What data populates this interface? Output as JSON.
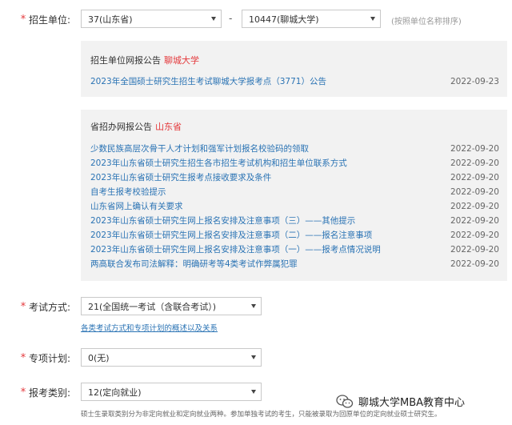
{
  "form": {
    "unit": {
      "label": "招生单位:",
      "province": "37(山东省)",
      "school": "10447(聊城大学)",
      "separator": "-",
      "hint": "(按照单位名称排序)"
    },
    "exam_method": {
      "label": "考试方式:",
      "value": "21(全国统一考试（含联合考试）)",
      "link": "各类考试方式和专项计划的概述以及关系"
    },
    "special_plan": {
      "label": "专项计划:",
      "value": "0(无)"
    },
    "category": {
      "label": "报考类别:",
      "value": "12(定向就业)",
      "note": "硕士生录取类别分为非定向就业和定向就业两种。参加单独考试的考生，只能被录取为回原单位的定向就业硕士研究生。"
    }
  },
  "school_notice": {
    "title": "招生单位网报公告",
    "source": "聊城大学",
    "items": [
      {
        "text": "2023年全国硕士研究生招生考试聊城大学报考点（3771）公告",
        "date": "2022-09-23"
      }
    ]
  },
  "province_notice": {
    "title": "省招办网报公告",
    "source": "山东省",
    "items": [
      {
        "text": "少数民族高层次骨干人才计划和强军计划报名校验码的领取",
        "date": "2022-09-20"
      },
      {
        "text": "2023年山东省硕士研究生招生各市招生考试机构和招生单位联系方式",
        "date": "2022-09-20"
      },
      {
        "text": "2023年山东省硕士研究生报考点接收要求及条件",
        "date": "2022-09-20"
      },
      {
        "text": "自考生报考校验提示",
        "date": "2022-09-20"
      },
      {
        "text": "山东省网上确认有关要求",
        "date": "2022-09-20"
      },
      {
        "text": "2023年山东省硕士研究生网上报名安排及注意事项（三）——其他提示",
        "date": "2022-09-20"
      },
      {
        "text": "2023年山东省硕士研究生网上报名安排及注意事项（二）——报名注意事项",
        "date": "2022-09-20"
      },
      {
        "text": "2023年山东省硕士研究生网上报名安排及注意事项（一）——报考点情况说明",
        "date": "2022-09-20"
      },
      {
        "text": "两高联合发布司法解释：明确研考等4类考试作弊属犯罪",
        "date": "2022-09-20"
      }
    ]
  },
  "watermark": {
    "text": "聊城大学MBA教育中心",
    "icon": "wechat-icon"
  },
  "colors": {
    "required": "#e4393c",
    "link": "#2a73b4",
    "panel_bg": "#f2f2f2"
  }
}
